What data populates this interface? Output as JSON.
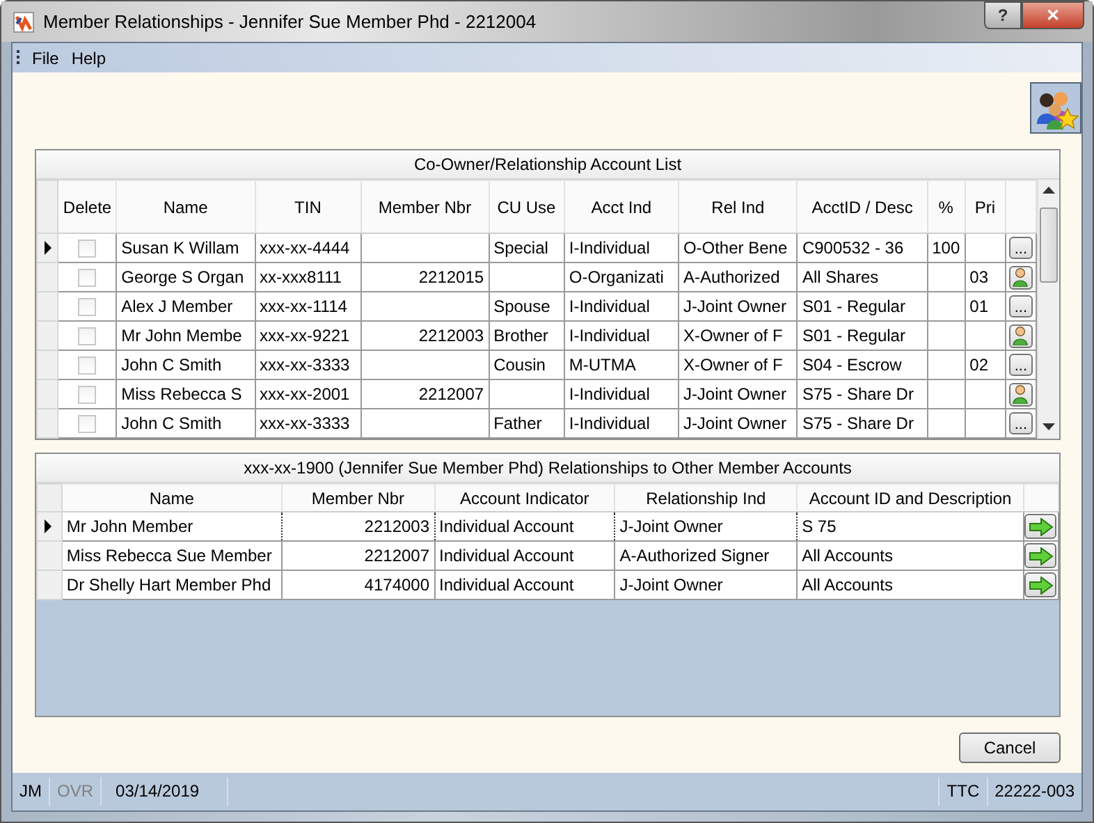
{
  "window": {
    "title": "Member Relationships - Jennifer Sue Member Phd - 2212004",
    "help_button": "?",
    "close_button": "✕"
  },
  "menu": [
    "File",
    "Help"
  ],
  "account_list": {
    "title": "Co-Owner/Relationship Account List",
    "columns": [
      "Delete",
      "Name",
      "TIN",
      "Member Nbr",
      "CU Use",
      "Acct Ind",
      "Rel Ind",
      "AcctID / Desc",
      "%",
      "Pri"
    ],
    "rows": [
      {
        "selected": true,
        "cells": [
          {
            "checked": false
          },
          "Susan K Willam",
          "xxx-xx-4444",
          "",
          "Special",
          "I-Individual",
          "O-Other Bene",
          "C900532 - 36",
          "100",
          ""
        ],
        "action": {
          "kind": "more",
          "label": "..."
        }
      },
      {
        "selected": false,
        "cells": [
          {
            "checked": false
          },
          "George S Organ",
          "xx-xxx8111",
          "2212015",
          "",
          "O-Organizati",
          "A-Authorized",
          "All Shares",
          "",
          "03"
        ],
        "action": {
          "kind": "person"
        }
      },
      {
        "selected": false,
        "cells": [
          {
            "checked": false
          },
          "Alex J Member",
          "xxx-xx-1114",
          "",
          "Spouse",
          "I-Individual",
          "J-Joint Owner",
          "S01 - Regular",
          "",
          "01"
        ],
        "action": {
          "kind": "more",
          "label": "..."
        }
      },
      {
        "selected": false,
        "cells": [
          {
            "checked": false
          },
          "Mr John Membe",
          "xxx-xx-9221",
          "2212003",
          "Brother",
          "I-Individual",
          "X-Owner of F",
          "S01 - Regular",
          "",
          ""
        ],
        "action": {
          "kind": "person"
        }
      },
      {
        "selected": false,
        "cells": [
          {
            "checked": false
          },
          "John C Smith",
          "xxx-xx-3333",
          "",
          "Cousin",
          "M-UTMA",
          "X-Owner of F",
          "S04 - Escrow",
          "",
          "02"
        ],
        "action": {
          "kind": "more",
          "label": "..."
        }
      },
      {
        "selected": false,
        "cells": [
          {
            "checked": false
          },
          "Miss Rebecca S",
          "xxx-xx-2001",
          "2212007",
          "",
          "I-Individual",
          "J-Joint Owner",
          "S75 - Share Dr",
          "",
          ""
        ],
        "action": {
          "kind": "person"
        }
      },
      {
        "selected": false,
        "cells": [
          {
            "checked": false
          },
          "John C Smith",
          "xxx-xx-3333",
          "",
          "Father",
          "I-Individual",
          "J-Joint Owner",
          "S75 - Share Dr",
          "",
          ""
        ],
        "action": {
          "kind": "more",
          "label": "..."
        }
      }
    ]
  },
  "other_accounts": {
    "title": "xxx-xx-1900 (Jennifer Sue Member Phd) Relationships to Other Member Accounts",
    "columns": [
      "Name",
      "Member Nbr",
      "Account Indicator",
      "Relationship Ind",
      "Account ID and Description"
    ],
    "rows": [
      {
        "selected": true,
        "cells": [
          "Mr John Member",
          "2212003",
          "Individual Account",
          "J-Joint Owner",
          "S 75"
        ]
      },
      {
        "selected": false,
        "cells": [
          "Miss Rebecca Sue Member",
          "2212007",
          "Individual Account",
          "A-Authorized Signer",
          "All Accounts"
        ]
      },
      {
        "selected": false,
        "cells": [
          "Dr Shelly Hart Member Phd",
          "4174000",
          "Individual Account",
          "J-Joint Owner",
          "All Accounts"
        ]
      }
    ]
  },
  "cancel_button": "Cancel",
  "status_bar": [
    {
      "text": "JM",
      "disabled": false
    },
    {
      "text": "OVR",
      "disabled": true
    },
    {
      "text": "03/14/2019",
      "disabled": false
    },
    {
      "text": "TTC",
      "disabled": false
    },
    {
      "text": "22222-003",
      "disabled": false
    }
  ]
}
